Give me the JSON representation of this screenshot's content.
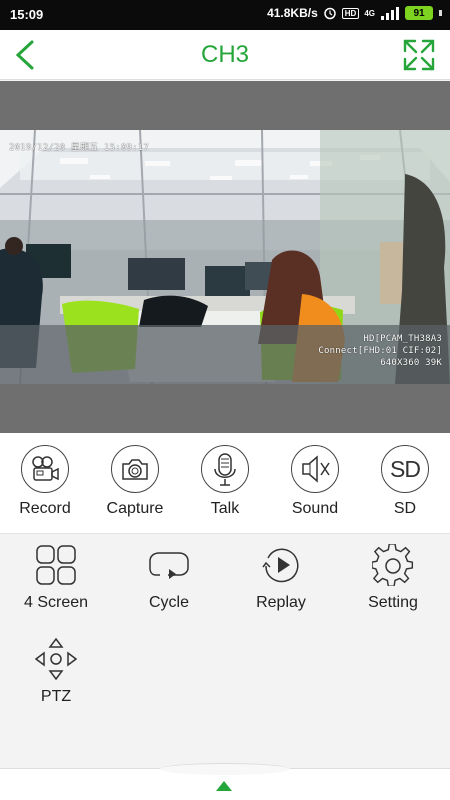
{
  "status": {
    "time": "15:09",
    "network_speed": "41.8KB/s",
    "hd_badge": "HD",
    "signal_label": "4G",
    "battery": "91",
    "icons": [
      "alarm-icon",
      "hd-icon",
      "signal-icon",
      "battery-icon"
    ]
  },
  "header": {
    "title": "CH3",
    "back_icon": "chevron-left-icon",
    "fullscreen_icon": "expand-icon",
    "accent_color": "#26a53a"
  },
  "video": {
    "timestamp": "2019/12/20  星期五  15:09:17",
    "camera_id": "HD[PCAM_TH38A3",
    "connection_info": "Connect[FHD:01 CIF:02]",
    "resolution_bitrate": "640X360 39K"
  },
  "controls": [
    {
      "label": "Record",
      "icon": "video-camera-icon"
    },
    {
      "label": "Capture",
      "icon": "camera-icon"
    },
    {
      "label": "Talk",
      "icon": "microphone-icon"
    },
    {
      "label": "Sound",
      "icon": "speaker-muted-icon"
    },
    {
      "label": "SD",
      "icon": "sd-card-icon"
    }
  ],
  "tools": [
    {
      "label": "4 Screen",
      "icon": "grid-icon"
    },
    {
      "label": "Cycle",
      "icon": "cycle-icon"
    },
    {
      "label": "Replay",
      "icon": "replay-icon"
    },
    {
      "label": "Setting",
      "icon": "gear-icon"
    },
    {
      "label": "PTZ",
      "icon": "ptz-icon"
    }
  ]
}
